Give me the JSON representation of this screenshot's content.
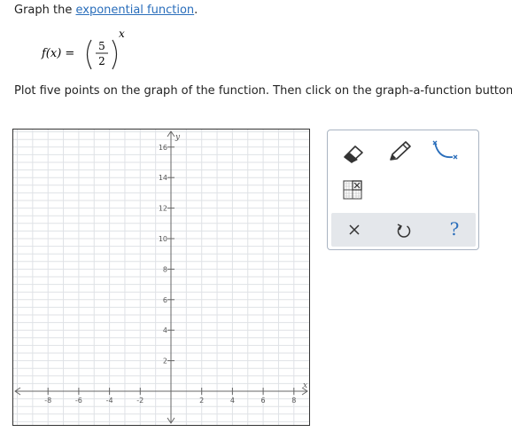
{
  "prompt": {
    "lead": "Graph the ",
    "link": "exponential function",
    "tail": "."
  },
  "formula": {
    "fx": "f(x) =",
    "numerator": "5",
    "denominator": "2",
    "exponent": "x"
  },
  "instruction": "Plot five points on the graph of the function. Then click on the graph-a-function button.",
  "graph": {
    "x_label": "x",
    "y_label": "y",
    "x_ticks": [
      -8,
      -6,
      -4,
      -2,
      2,
      4,
      6,
      8
    ],
    "y_ticks": [
      2,
      4,
      6,
      8,
      10,
      12,
      14,
      16
    ]
  },
  "toolbar": {
    "help_label": "?",
    "icons": [
      "eraser-icon",
      "pencil-icon",
      "curve-icon",
      "graph-function-icon",
      "close-icon",
      "undo-icon"
    ],
    "accent": "#2a6ebb"
  }
}
